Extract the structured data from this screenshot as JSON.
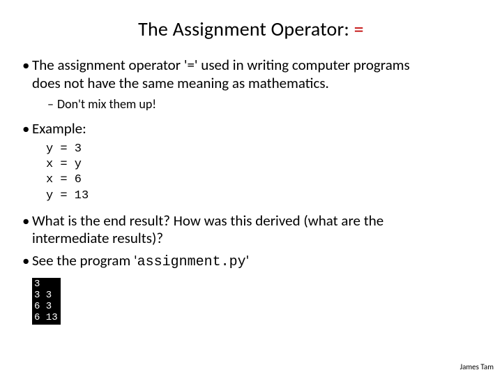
{
  "title_main": "The Assignment Operator: ",
  "title_accent": "=",
  "bullets": {
    "b1a": "The assignment operator '=' used in writing computer programs",
    "b1b": "does not have the same meaning as mathematics.",
    "sub1": "Don't mix them up!",
    "b2": "Example:",
    "code": "y = 3\nx = y\nx = 6\ny = 13",
    "b3a": "What is the end result? How was this derived (what are the",
    "b3b": "intermediate results)?",
    "b4_pre": "See the program '",
    "b4_mono": "assignment.py",
    "b4_post": "'"
  },
  "terminal": "3\n3 3\n6 3\n6 13",
  "footer": "James Tam"
}
